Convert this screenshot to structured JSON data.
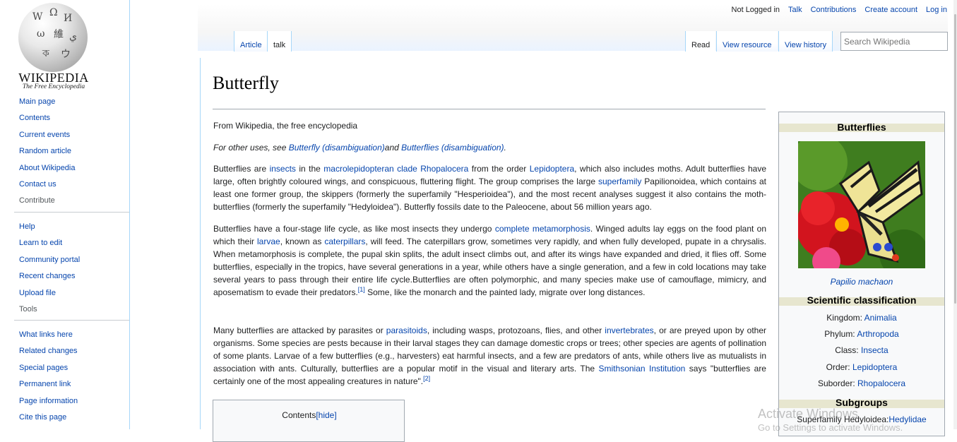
{
  "sidebar": {
    "logo_word": "Wikipedia",
    "logo_tag": "The Free Encyclopedia",
    "nav": [
      "Main page",
      "Contents",
      "Current events",
      "Random article",
      "About Wikipedia",
      "Contact us",
      "Contribute"
    ],
    "interaction": [
      "Help",
      "Learn to edit",
      "Community portal",
      "Recent changes",
      "Upload file",
      "Tools"
    ],
    "tools": [
      "What links here",
      "Related changes",
      "Special pages",
      "Permanent link",
      "Page information",
      "Cite this page"
    ]
  },
  "personal": {
    "status": "Not Logged in",
    "talk": "Talk",
    "contributions": "Contributions",
    "create_account": "Create account",
    "login": "Log in"
  },
  "tabs": {
    "article": "Article",
    "talk": "talk",
    "read": "Read",
    "view_resource": "View resource",
    "view_history": "View history"
  },
  "search": {
    "placeholder": "Search Wikipedia"
  },
  "article": {
    "title": "Butterfly",
    "tagline": "From Wikipedia, the free encyclopedia",
    "hatnote": {
      "prefix": "For other uses, see ",
      "link1": "Butterfly (disambiguation)",
      "middle": "and ",
      "link2": "Butterflies (disambiguation)",
      "suffix": "."
    },
    "p1": {
      "t1": "Butterflies are ",
      "l1": "insects",
      "t2": " in the ",
      "l2": "macrolepidopteran clade Rhopalocera",
      "t3": " from the order ",
      "l3": "Lepidoptera",
      "t4": ", which also includes moths. Adult butterflies have large, often brightly coloured wings, and conspicuous, fluttering flight. The group comprises the large ",
      "l4": "superfamily",
      "t5": " Papilionoidea, which contains at least one former group, the skippers (formerly the superfamily \"Hesperioidea\"), and the most recent analyses suggest it also contains the moth-butterflies (formerly the superfamily \"Hedyloidea\"). Butterfly fossils date to the Paleocene, about 56 million years ago."
    },
    "p2": {
      "t1": "Butterflies have a four-stage life cycle, as like most insects they undergo ",
      "l1": "complete metamorphosis",
      "t2": ". Winged adults lay eggs on the food plant on which their ",
      "l2": "larvae",
      "t3": ", known as ",
      "l3": "caterpillars",
      "t4": ", will feed. The caterpillars grow, sometimes very rapidly, and when fully developed, pupate in a chrysalis. When metamorphosis is complete, the pupal skin splits, the adult insect climbs out, and after its wings have expanded and dried, it flies off. Some butterflies, especially in the tropics, have several generations in a year, while others have a single generation, and a few in cold locations may take several years to pass through their entire life cycle.Butterflies are often polymorphic, and many species make use of camouflage, mimicry, and aposematism to evade their predators.",
      "ref": "[1]",
      "t5": " Some, like the monarch and the painted lady, migrate over long distances."
    },
    "p3": {
      "t1": "Many butterflies are attacked by parasites or ",
      "l1": "parasitoids",
      "t2": ", including wasps, protozoans, flies, and other ",
      "l2": "invertebrates",
      "t3": ", or are preyed upon by other organisms. Some species are pests because in their larval stages they can damage domestic crops or trees; other species are agents of pollination of some plants. Larvae of a few butterflies (e.g., harvesters) eat harmful insects, and a few are predators of ants, while others live as mutualists in association with ants. Culturally, butterflies are a popular motif in the visual and literary arts. The ",
      "l3": "Smithsonian Institution",
      "t4": " says \"butterflies are certainly one of the most appealing creatures in nature\".",
      "ref": "[2]"
    },
    "toc": {
      "label": "Contents",
      "toggle": "[hide]"
    }
  },
  "infobox": {
    "title": "Butterflies",
    "caption": "Papilio machaon",
    "classification_title": "Scientific classification",
    "rows": [
      {
        "label": "Kingdom: ",
        "value": "Animalia"
      },
      {
        "label": "Phylum: ",
        "value": "Arthropoda"
      },
      {
        "label": "Class: ",
        "value": "Insecta"
      },
      {
        "label": "Order: ",
        "value": "Lepidoptera"
      },
      {
        "label": "Suborder: ",
        "value": "Rhopalocera"
      }
    ],
    "subgroups_title": "Subgroups",
    "subgroup_label": "Superfamily Hedyloidea:",
    "subgroup_value": "Hedylidae"
  },
  "watermark": {
    "line1": "Activate Windows",
    "line2": "Go to Settings to activate Windows."
  }
}
